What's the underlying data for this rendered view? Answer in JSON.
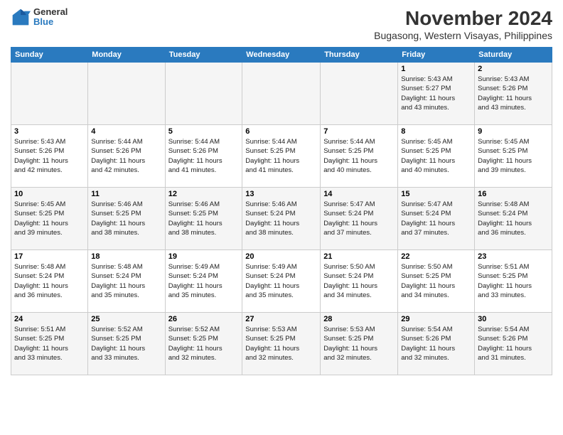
{
  "header": {
    "logo": {
      "line1": "General",
      "line2": "Blue"
    },
    "title": "November 2024",
    "subtitle": "Bugasong, Western Visayas, Philippines"
  },
  "days_of_week": [
    "Sunday",
    "Monday",
    "Tuesday",
    "Wednesday",
    "Thursday",
    "Friday",
    "Saturday"
  ],
  "weeks": [
    [
      {
        "day": "",
        "info": ""
      },
      {
        "day": "",
        "info": ""
      },
      {
        "day": "",
        "info": ""
      },
      {
        "day": "",
        "info": ""
      },
      {
        "day": "",
        "info": ""
      },
      {
        "day": "1",
        "info": "Sunrise: 5:43 AM\nSunset: 5:27 PM\nDaylight: 11 hours\nand 43 minutes."
      },
      {
        "day": "2",
        "info": "Sunrise: 5:43 AM\nSunset: 5:26 PM\nDaylight: 11 hours\nand 43 minutes."
      }
    ],
    [
      {
        "day": "3",
        "info": "Sunrise: 5:43 AM\nSunset: 5:26 PM\nDaylight: 11 hours\nand 42 minutes."
      },
      {
        "day": "4",
        "info": "Sunrise: 5:44 AM\nSunset: 5:26 PM\nDaylight: 11 hours\nand 42 minutes."
      },
      {
        "day": "5",
        "info": "Sunrise: 5:44 AM\nSunset: 5:26 PM\nDaylight: 11 hours\nand 41 minutes."
      },
      {
        "day": "6",
        "info": "Sunrise: 5:44 AM\nSunset: 5:25 PM\nDaylight: 11 hours\nand 41 minutes."
      },
      {
        "day": "7",
        "info": "Sunrise: 5:44 AM\nSunset: 5:25 PM\nDaylight: 11 hours\nand 40 minutes."
      },
      {
        "day": "8",
        "info": "Sunrise: 5:45 AM\nSunset: 5:25 PM\nDaylight: 11 hours\nand 40 minutes."
      },
      {
        "day": "9",
        "info": "Sunrise: 5:45 AM\nSunset: 5:25 PM\nDaylight: 11 hours\nand 39 minutes."
      }
    ],
    [
      {
        "day": "10",
        "info": "Sunrise: 5:45 AM\nSunset: 5:25 PM\nDaylight: 11 hours\nand 39 minutes."
      },
      {
        "day": "11",
        "info": "Sunrise: 5:46 AM\nSunset: 5:25 PM\nDaylight: 11 hours\nand 38 minutes."
      },
      {
        "day": "12",
        "info": "Sunrise: 5:46 AM\nSunset: 5:25 PM\nDaylight: 11 hours\nand 38 minutes."
      },
      {
        "day": "13",
        "info": "Sunrise: 5:46 AM\nSunset: 5:24 PM\nDaylight: 11 hours\nand 38 minutes."
      },
      {
        "day": "14",
        "info": "Sunrise: 5:47 AM\nSunset: 5:24 PM\nDaylight: 11 hours\nand 37 minutes."
      },
      {
        "day": "15",
        "info": "Sunrise: 5:47 AM\nSunset: 5:24 PM\nDaylight: 11 hours\nand 37 minutes."
      },
      {
        "day": "16",
        "info": "Sunrise: 5:48 AM\nSunset: 5:24 PM\nDaylight: 11 hours\nand 36 minutes."
      }
    ],
    [
      {
        "day": "17",
        "info": "Sunrise: 5:48 AM\nSunset: 5:24 PM\nDaylight: 11 hours\nand 36 minutes."
      },
      {
        "day": "18",
        "info": "Sunrise: 5:48 AM\nSunset: 5:24 PM\nDaylight: 11 hours\nand 35 minutes."
      },
      {
        "day": "19",
        "info": "Sunrise: 5:49 AM\nSunset: 5:24 PM\nDaylight: 11 hours\nand 35 minutes."
      },
      {
        "day": "20",
        "info": "Sunrise: 5:49 AM\nSunset: 5:24 PM\nDaylight: 11 hours\nand 35 minutes."
      },
      {
        "day": "21",
        "info": "Sunrise: 5:50 AM\nSunset: 5:24 PM\nDaylight: 11 hours\nand 34 minutes."
      },
      {
        "day": "22",
        "info": "Sunrise: 5:50 AM\nSunset: 5:25 PM\nDaylight: 11 hours\nand 34 minutes."
      },
      {
        "day": "23",
        "info": "Sunrise: 5:51 AM\nSunset: 5:25 PM\nDaylight: 11 hours\nand 33 minutes."
      }
    ],
    [
      {
        "day": "24",
        "info": "Sunrise: 5:51 AM\nSunset: 5:25 PM\nDaylight: 11 hours\nand 33 minutes."
      },
      {
        "day": "25",
        "info": "Sunrise: 5:52 AM\nSunset: 5:25 PM\nDaylight: 11 hours\nand 33 minutes."
      },
      {
        "day": "26",
        "info": "Sunrise: 5:52 AM\nSunset: 5:25 PM\nDaylight: 11 hours\nand 32 minutes."
      },
      {
        "day": "27",
        "info": "Sunrise: 5:53 AM\nSunset: 5:25 PM\nDaylight: 11 hours\nand 32 minutes."
      },
      {
        "day": "28",
        "info": "Sunrise: 5:53 AM\nSunset: 5:25 PM\nDaylight: 11 hours\nand 32 minutes."
      },
      {
        "day": "29",
        "info": "Sunrise: 5:54 AM\nSunset: 5:26 PM\nDaylight: 11 hours\nand 32 minutes."
      },
      {
        "day": "30",
        "info": "Sunrise: 5:54 AM\nSunset: 5:26 PM\nDaylight: 11 hours\nand 31 minutes."
      }
    ]
  ]
}
